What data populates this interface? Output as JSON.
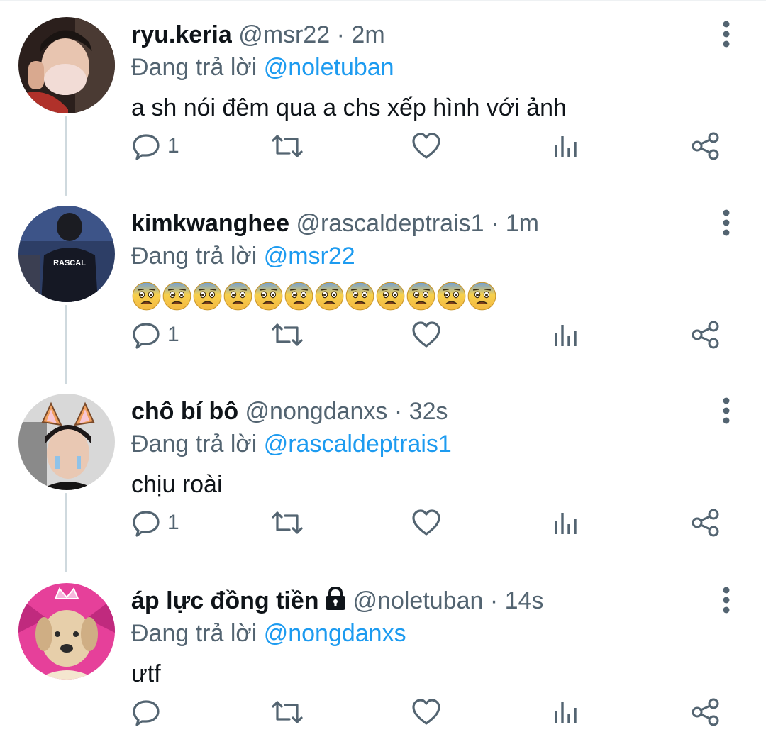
{
  "colors": {
    "accent": "#1d9bf0",
    "secondary_text": "#536471",
    "primary_text": "#0f1419",
    "thread_line": "#cfd9de"
  },
  "tweets": [
    {
      "display_name": "ryu.keria",
      "handle": "@msr22",
      "time": "2m",
      "replying_prefix": "Đang trả lời ",
      "replying_to": "@noletuban",
      "text": "a sh nói đêm qua a chs xếp hình với ảnh",
      "reply_count": "1",
      "avatar_icon": "user-avatar-mask"
    },
    {
      "display_name": "kimkwanghee",
      "handle": "@rascaldeptrais1",
      "time": "1m",
      "replying_prefix": "Đang trả lời ",
      "replying_to": "@msr22",
      "emoji_count": 12,
      "emoji_name": "anxious-face-emoji",
      "reply_count": "1",
      "avatar_icon": "user-avatar-jacket",
      "avatar_jacket_text": "RASCAL"
    },
    {
      "display_name": "chô bí bô",
      "handle": "@nongdanxs",
      "time": "32s",
      "replying_prefix": "Đang trả lời ",
      "replying_to": "@rascaldeptrais1",
      "text": "chịu roài",
      "reply_count": "1",
      "avatar_icon": "user-avatar-cat-ears"
    },
    {
      "display_name": "áp lực đồng tiền",
      "handle": "@noletuban",
      "time": "14s",
      "replying_prefix": "Đang trả lời ",
      "replying_to": "@nongdanxs",
      "text": "ưtf",
      "reply_count": "",
      "avatar_icon": "user-avatar-puppy",
      "protected": true
    }
  ],
  "separator": " · "
}
